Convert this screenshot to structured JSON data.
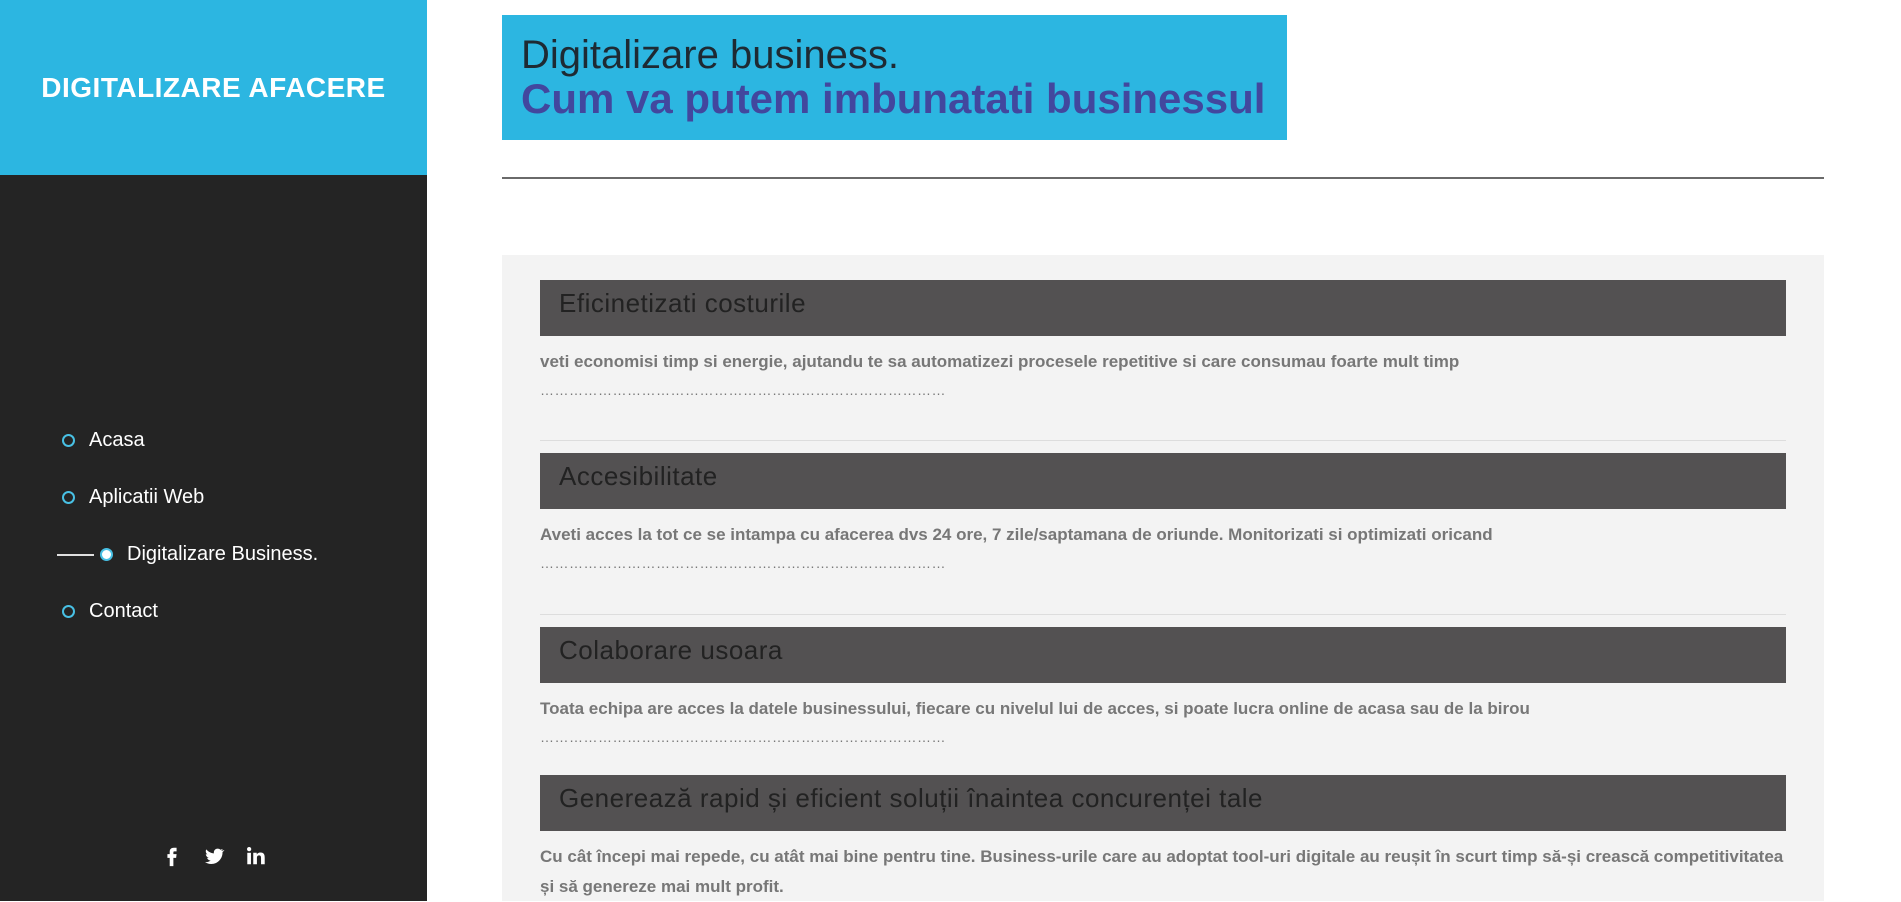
{
  "sidebar": {
    "brand": "DIGITALIZARE AFACERE",
    "nav": [
      {
        "label": "Acasa",
        "active": false
      },
      {
        "label": "Aplicatii Web",
        "active": false
      },
      {
        "label": "Digitalizare Business.",
        "active": true
      },
      {
        "label": "Contact",
        "active": false
      }
    ],
    "social": [
      "facebook-icon",
      "twitter-icon",
      "linkedin-icon"
    ]
  },
  "header": {
    "line1": "Digitalizare business.",
    "line2": "Cum va putem imbunatati businessul"
  },
  "features": [
    {
      "title": "Eficinetizati costurile",
      "text": "veti economisi timp si energie, ajutandu te sa automatizezi procesele repetitive si care consumau foarte mult timp",
      "dots": "…………………………………………………………………………"
    },
    {
      "title": "Accesibilitate",
      "text": "Aveti acces la tot ce se intampa cu afacerea dvs 24 ore, 7 zile/saptamana de oriunde. Monitorizati si optimizati oricand",
      "dots": "…………………………………………………………………………"
    },
    {
      "title": "Colaborare usoara",
      "text": "Toata echipa are acces la datele businessului, fiecare cu nivelul lui de acces, si poate lucra online de acasa sau de la birou",
      "dots": "…………………………………………………………………………"
    },
    {
      "title": "Generează rapid și eficient soluții înaintea concurenței tale",
      "text": "Cu cât începi mai repede, cu atât mai bine pentru tine. Business-urile care au adoptat tool-uri digitale au reușit în scurt timp să-și crească competitivitatea și să genereze mai mult profit."
    }
  ],
  "colors": {
    "accent": "#2cb6e1",
    "sidebar_bg": "#242424",
    "heading_purple": "#42479e",
    "feature_head_bg": "#535152",
    "panel_bg": "#f3f3f3"
  }
}
